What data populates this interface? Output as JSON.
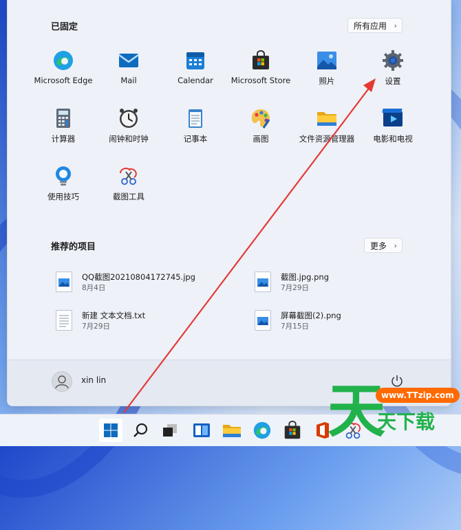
{
  "pinned": {
    "title": "已固定",
    "all_apps_label": "所有应用",
    "apps": [
      {
        "label": "Microsoft Edge",
        "icon": "edge-icon"
      },
      {
        "label": "Mail",
        "icon": "mail-icon"
      },
      {
        "label": "Calendar",
        "icon": "calendar-icon"
      },
      {
        "label": "Microsoft Store",
        "icon": "store-icon"
      },
      {
        "label": "照片",
        "icon": "photos-icon"
      },
      {
        "label": "设置",
        "icon": "settings-gear-icon"
      },
      {
        "label": "计算器",
        "icon": "calculator-icon"
      },
      {
        "label": "闹钟和时钟",
        "icon": "clock-icon"
      },
      {
        "label": "记事本",
        "icon": "notepad-icon"
      },
      {
        "label": "画图",
        "icon": "paint-icon"
      },
      {
        "label": "文件资源管理器",
        "icon": "folder-icon"
      },
      {
        "label": "电影和电视",
        "icon": "movies-icon"
      },
      {
        "label": "使用技巧",
        "icon": "tips-icon"
      },
      {
        "label": "截图工具",
        "icon": "snipping-tool-icon"
      }
    ]
  },
  "recommended": {
    "title": "推荐的项目",
    "more_label": "更多",
    "items": [
      {
        "name": "QQ截图20210804172745.jpg",
        "date": "8月4日",
        "icon": "image-file-icon"
      },
      {
        "name": "截图.jpg.png",
        "date": "7月29日",
        "icon": "image-file-icon"
      },
      {
        "name": "新建 文本文档.txt",
        "date": "7月29日",
        "icon": "text-file-icon"
      },
      {
        "name": "屏幕截图(2).png",
        "date": "7月15日",
        "icon": "image-file-icon"
      }
    ]
  },
  "user": {
    "name": "xin lin",
    "power_icon": "power-icon"
  },
  "taskbar": {
    "icons": [
      "start-icon",
      "search-icon",
      "task-view-icon",
      "widgets-icon",
      "file-explorer-icon",
      "edge-icon",
      "store-icon",
      "office-icon",
      "snipping-tool-icon"
    ]
  },
  "watermark": {
    "logo_char": "天",
    "url": "www.TTzip.com",
    "text": "天下载"
  },
  "colors": {
    "accent": "#0067c0",
    "arrow": "#e53935",
    "watermark_green": "#22b24c"
  }
}
